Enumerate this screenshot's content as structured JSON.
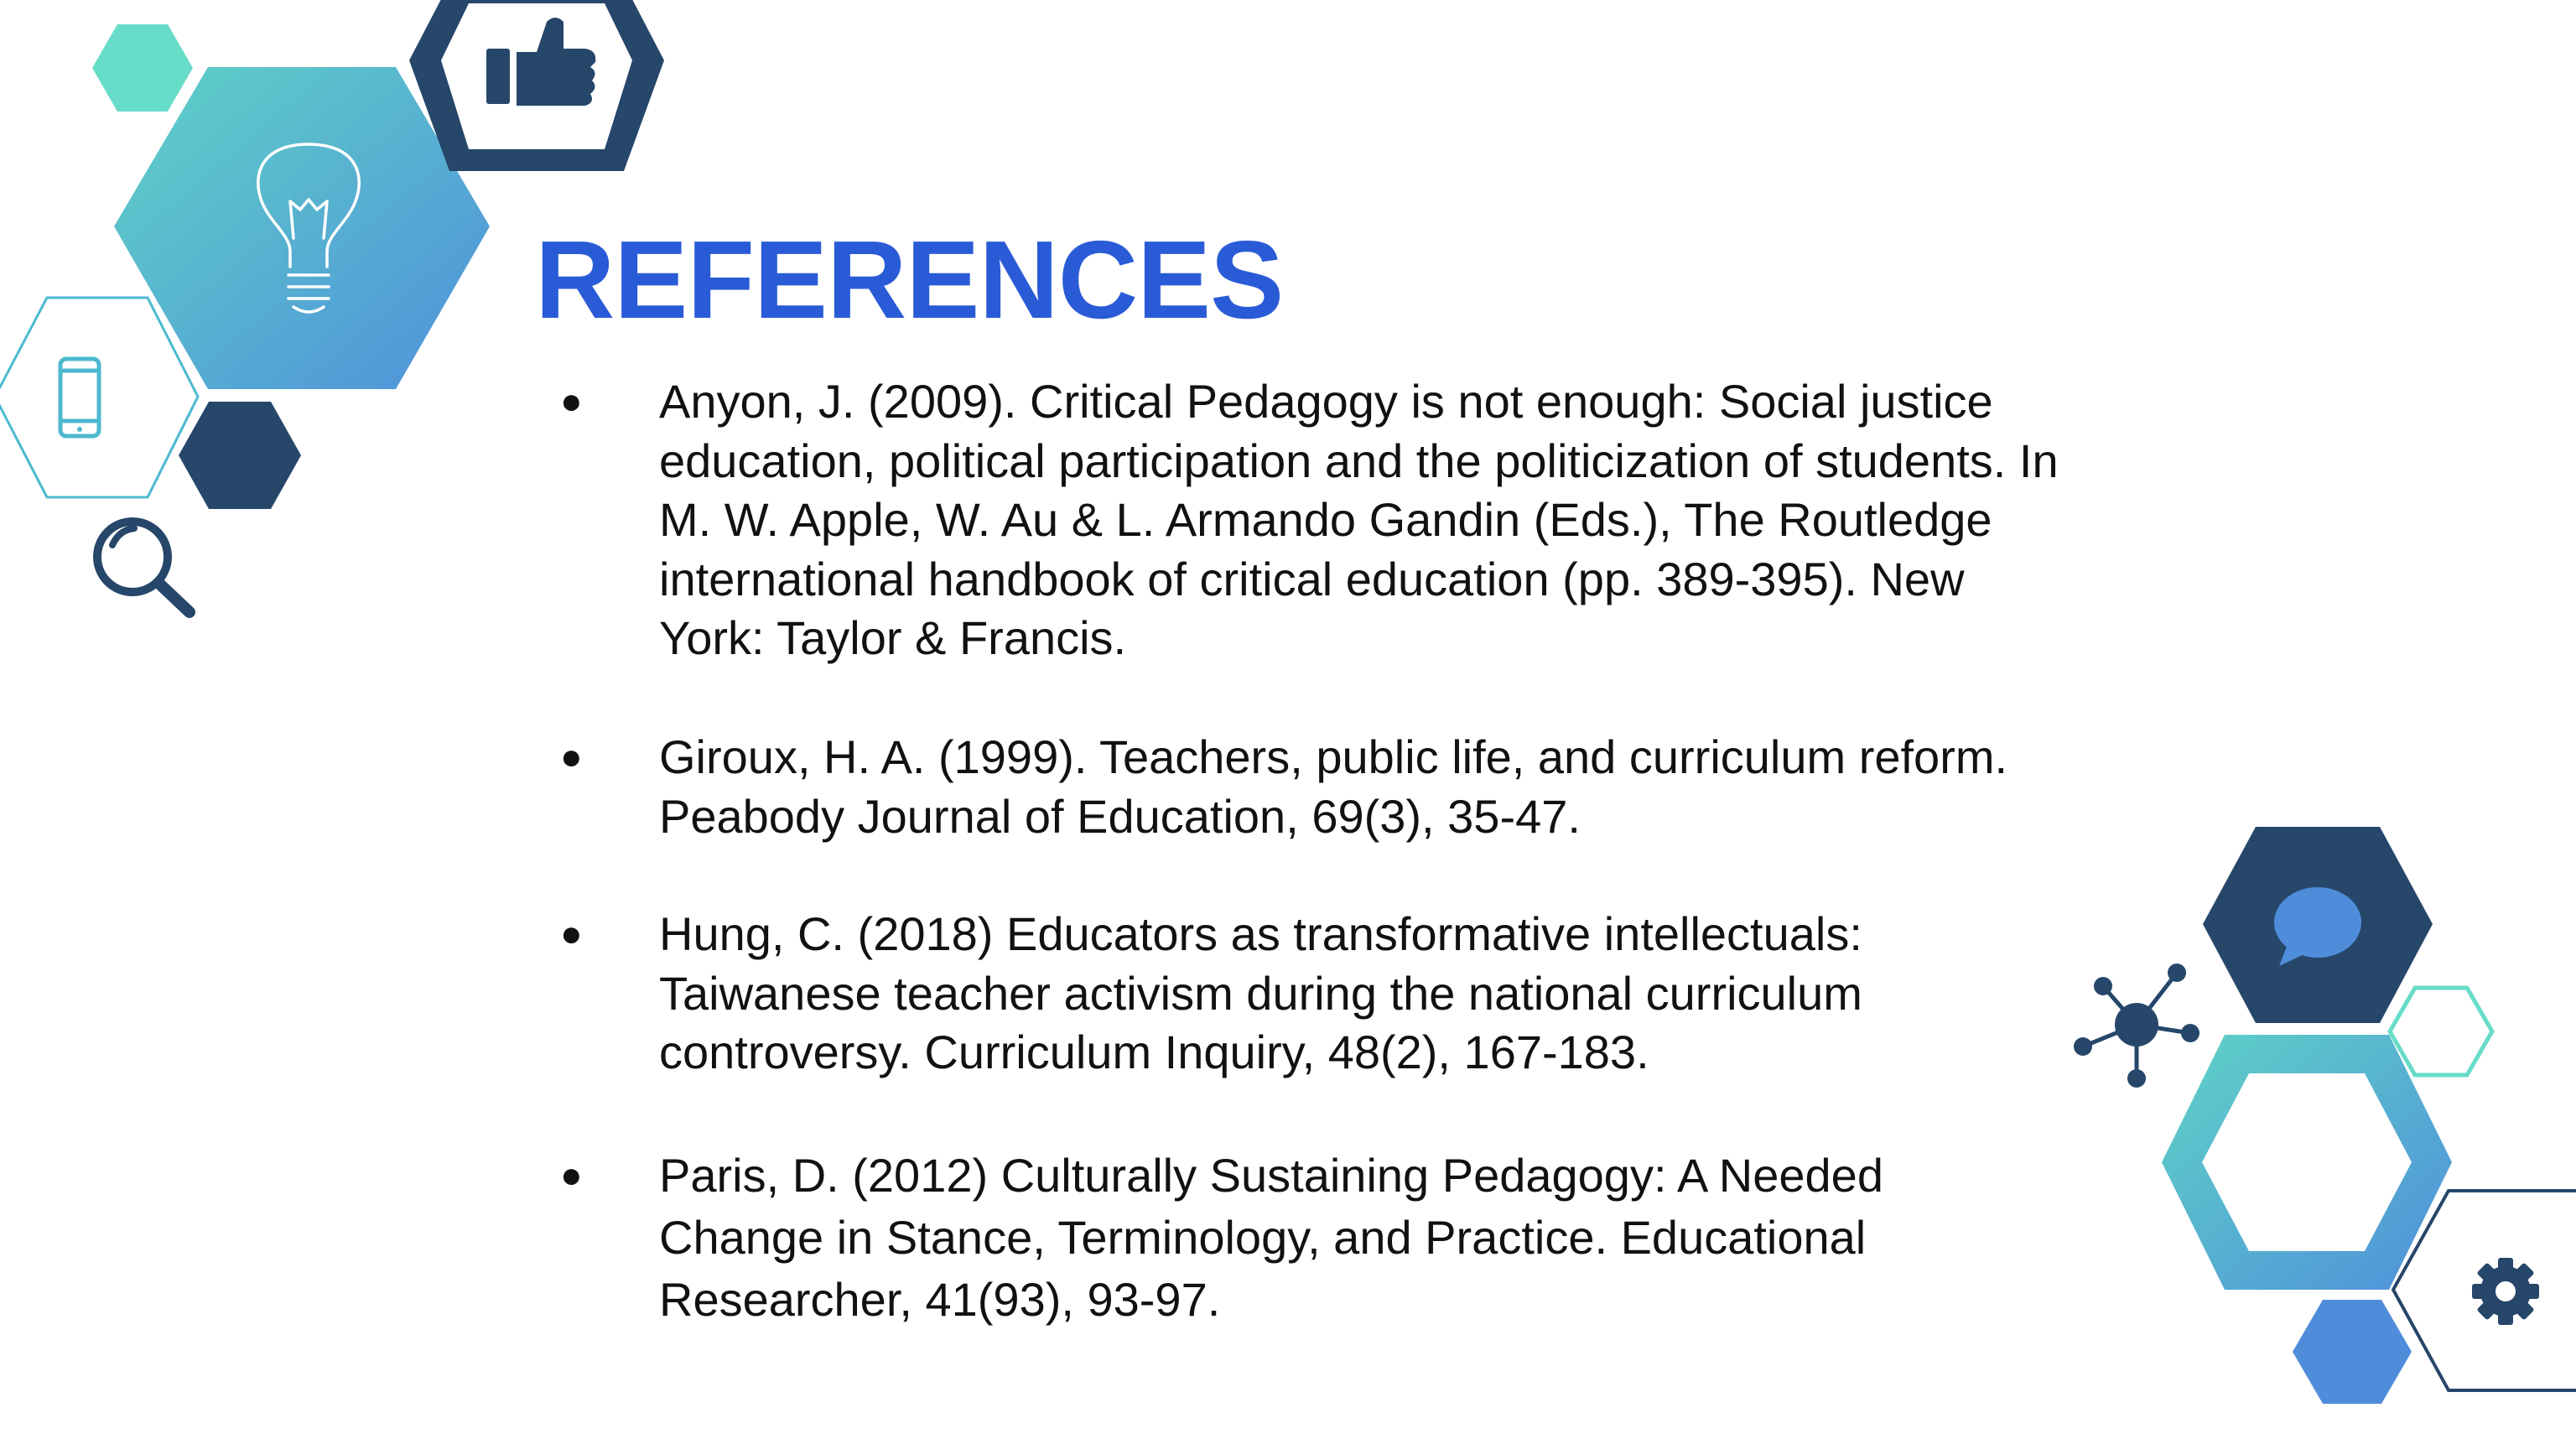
{
  "slide": {
    "title": "REFERENCES",
    "references": [
      {
        "lines": [
          "Anyon, J. (2009). Critical Pedagogy is not enough: Social justice",
          "education, political participation and the politicization of students. In",
          "M. W. Apple, W. Au & L. Armando Gandin (Eds.), The Routledge",
          "international handbook of critical education (pp. 389-395). New",
          "York: Taylor & Francis."
        ]
      },
      {
        "lines": [
          "Giroux, H. A. (1999). Teachers, public life, and curriculum reform.",
          "Peabody Journal of Education, 69(3), 35-47."
        ]
      },
      {
        "lines": [
          "Hung, C. (2018) Educators as transformative intellectuals:",
          "Taiwanese teacher activism during the national curriculum",
          "controversy. Curriculum Inquiry, 48(2), 167-183."
        ]
      },
      {
        "lines": [
          "Paris, D. (2012) Culturally Sustaining Pedagogy: A Needed",
          "Change in Stance, Terminology, and Practice. Educational",
          "Researcher, 41(93), 93-97."
        ]
      }
    ],
    "bullet_glyph": "●"
  },
  "decorations": {
    "top_left": [
      "lightbulb-icon",
      "thumbs-up-icon",
      "smartphone-icon",
      "magnifier-icon"
    ],
    "bottom_right": [
      "chat-bubble-icon",
      "network-hub-icon",
      "gear-icon"
    ]
  },
  "colors": {
    "title": "#2a5bd7",
    "navy": "#26466a",
    "teal": "#67dcc8",
    "gradient_start": "#5fd3c6",
    "gradient_end": "#4f8fdb",
    "blue": "#4f8ddb",
    "text": "#111111"
  }
}
